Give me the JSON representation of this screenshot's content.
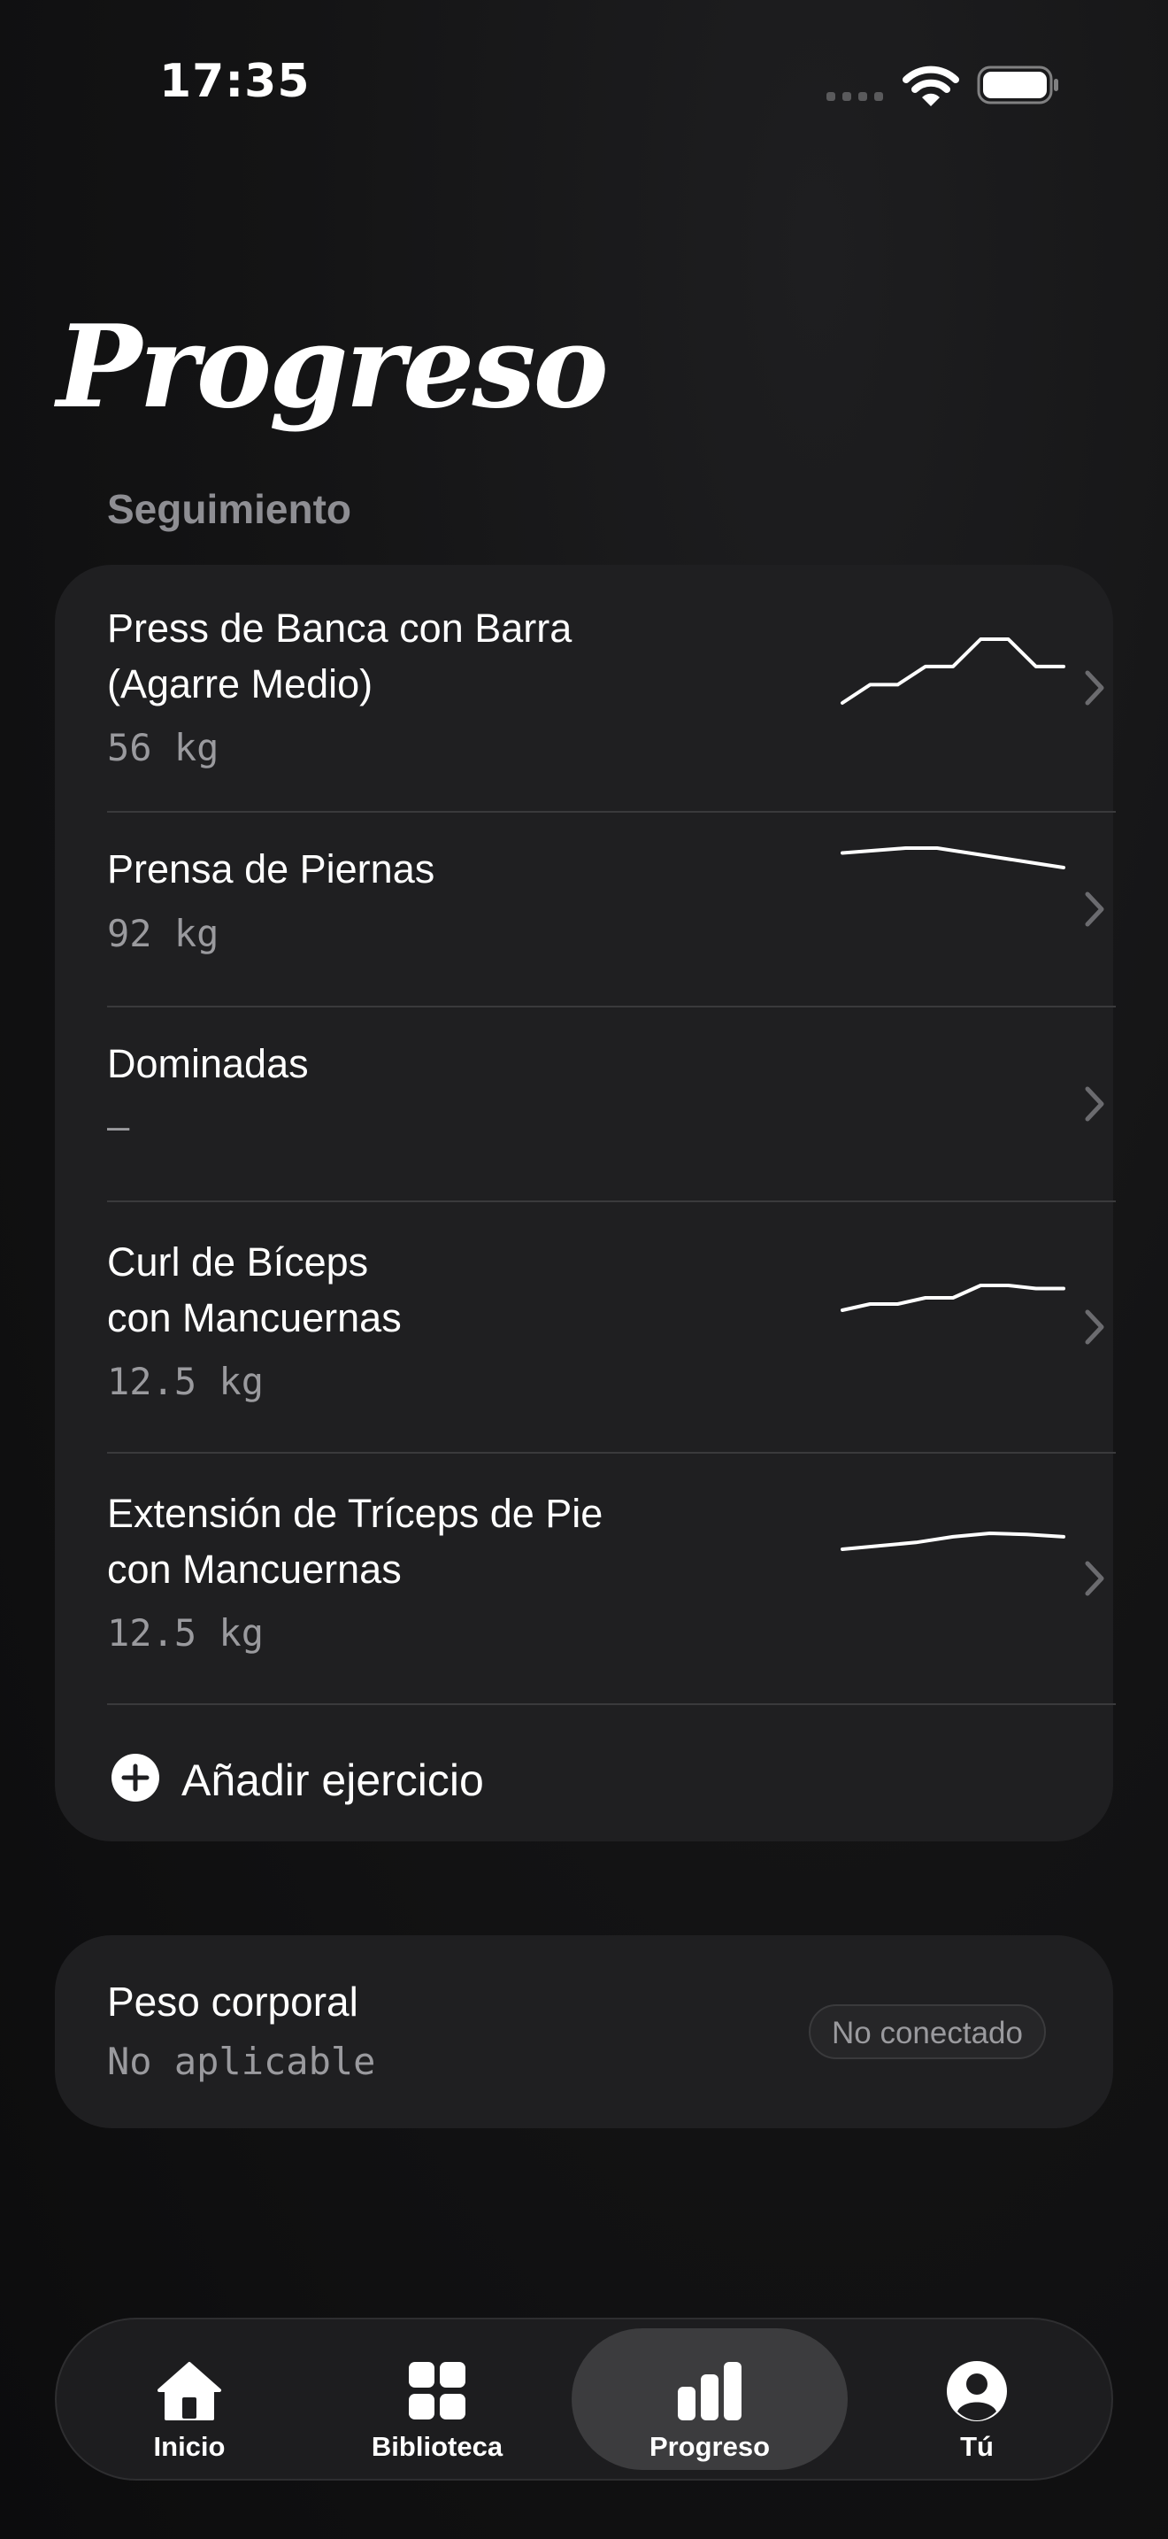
{
  "status_bar": {
    "time": "17:35"
  },
  "header": {
    "title": "Progreso",
    "section_label": "Seguimiento"
  },
  "exercises": [
    {
      "name_line1": "Press de Banca con Barra",
      "name_line2": "(Agarre Medio)",
      "value": "56 kg",
      "trend": [
        9,
        7,
        7,
        5,
        5,
        2,
        2,
        5,
        5
      ]
    },
    {
      "name_line1": "Prensa de Piernas",
      "name_line2": "",
      "value": "92 kg",
      "trend": [
        3,
        2.5,
        2,
        2,
        3,
        4,
        5,
        6
      ]
    },
    {
      "name_line1": "Dominadas",
      "name_line2": "",
      "value": "—",
      "trend": []
    },
    {
      "name_line1": "Curl de Bíceps",
      "name_line2": "con Mancuernas",
      "value": "12.5 kg",
      "trend": [
        20,
        16,
        16,
        12,
        12,
        4,
        4,
        6,
        6
      ]
    },
    {
      "name_line1": "Extensión de Tríceps de Pie",
      "name_line2": "con Mancuernas",
      "value": "12.5 kg",
      "trend": [
        16,
        13,
        10,
        5,
        2,
        3,
        5
      ]
    }
  ],
  "add_exercise": {
    "label": "Añadir ejercicio"
  },
  "body_weight": {
    "title": "Peso corporal",
    "value": "No aplicable",
    "status": "No conectado"
  },
  "tab_bar": {
    "tabs": [
      {
        "label": "Inicio",
        "icon": "home-icon"
      },
      {
        "label": "Biblioteca",
        "icon": "grid-icon"
      },
      {
        "label": "Progreso",
        "icon": "bar-chart-icon",
        "active": true
      },
      {
        "label": "Tú",
        "icon": "profile-icon"
      }
    ]
  },
  "colors": {
    "background": "#141415",
    "card": "#1f1f21",
    "text": "#ffffff",
    "secondary_text": "#9a9a9e",
    "active_tab": "#3c3c3e"
  }
}
